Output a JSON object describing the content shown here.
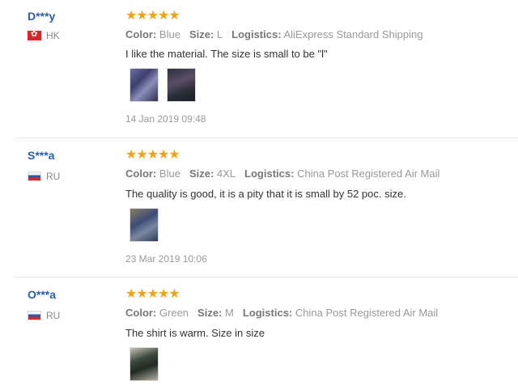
{
  "reviews": [
    {
      "user": "D***y",
      "country": "HK",
      "flag": "hk-flag",
      "stars": "★★★★★",
      "rating": 5,
      "color_label": "Color:",
      "color": "Blue",
      "size_label": "Size:",
      "size": "L",
      "logistics_label": "Logistics:",
      "logistics": "AliExpress Standard Shipping",
      "text": "I like the material. The size is small to be \"l\"",
      "photos": [
        "review-photo",
        "review-photo"
      ],
      "date": "14 Jan 2019 09:48"
    },
    {
      "user": "S***a",
      "country": "RU",
      "flag": "ru-flag",
      "stars": "★★★★★",
      "rating": 5,
      "color_label": "Color:",
      "color": "Blue",
      "size_label": "Size:",
      "size": "4XL",
      "logistics_label": "Logistics:",
      "logistics": "China Post Registered Air Mail",
      "text": "The quality is good, it is a pity that it is small by 52 poc. size.",
      "photos": [
        "review-photo"
      ],
      "date": "23 Mar 2019 10:06"
    },
    {
      "user": "O***a",
      "country": "RU",
      "flag": "ru-flag",
      "stars": "★★★★★",
      "rating": 5,
      "color_label": "Color:",
      "color": "Green",
      "size_label": "Size:",
      "size": "M",
      "logistics_label": "Logistics:",
      "logistics": "China Post Registered Air Mail",
      "text": "The shirt is warm. Size in size",
      "photos": [
        "review-photo"
      ]
    }
  ],
  "colors": {
    "user_link": "#2a5db0",
    "star": "#f4a212",
    "muted": "#999999"
  }
}
